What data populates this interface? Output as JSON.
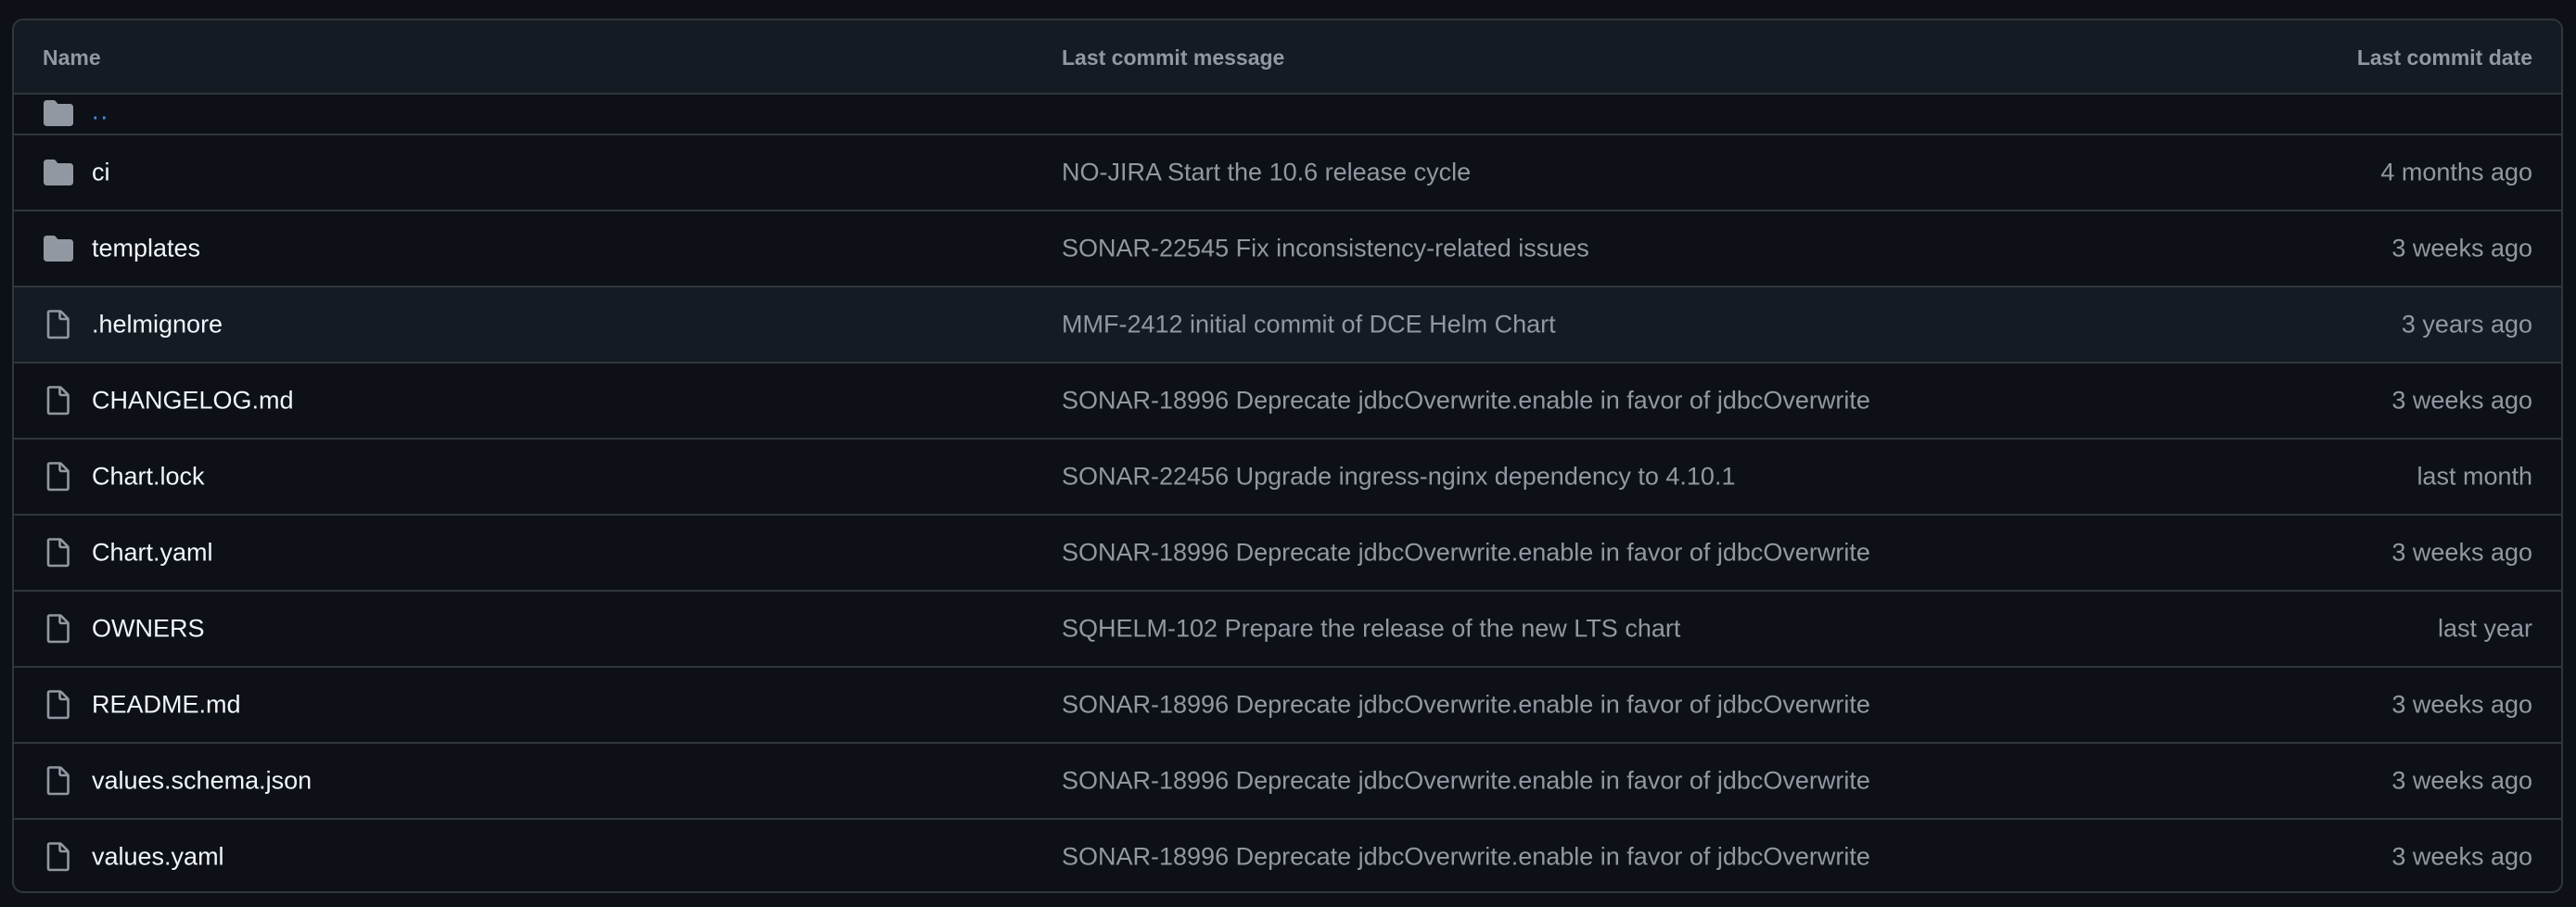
{
  "header": {
    "name": "Name",
    "message": "Last commit message",
    "date": "Last commit date"
  },
  "parent": {
    "label": "..",
    "icon": "folder-icon"
  },
  "rows": [
    {
      "name": "ci",
      "type": "dir",
      "icon": "folder-icon",
      "message": "NO-JIRA Start the 10.6 release cycle",
      "date": "4 months ago"
    },
    {
      "name": "templates",
      "type": "dir",
      "icon": "folder-icon",
      "message": "SONAR-22545 Fix inconsistency-related issues",
      "date": "3 weeks ago"
    },
    {
      "name": ".helmignore",
      "type": "file",
      "icon": "file-icon",
      "message": "MMF-2412 initial commit of DCE Helm Chart",
      "date": "3 years ago"
    },
    {
      "name": "CHANGELOG.md",
      "type": "file",
      "icon": "file-icon",
      "message": "SONAR-18996 Deprecate jdbcOverwrite.enable in favor of jdbcOverwrite",
      "date": "3 weeks ago"
    },
    {
      "name": "Chart.lock",
      "type": "file",
      "icon": "file-icon",
      "message": "SONAR-22456 Upgrade ingress-nginx dependency to 4.10.1",
      "date": "last month"
    },
    {
      "name": "Chart.yaml",
      "type": "file",
      "icon": "file-icon",
      "message": "SONAR-18996 Deprecate jdbcOverwrite.enable in favor of jdbcOverwrite",
      "date": "3 weeks ago"
    },
    {
      "name": "OWNERS",
      "type": "file",
      "icon": "file-icon",
      "message": "SQHELM-102 Prepare the release of the new LTS chart",
      "date": "last year"
    },
    {
      "name": "README.md",
      "type": "file",
      "icon": "file-icon",
      "message": "SONAR-18996 Deprecate jdbcOverwrite.enable in favor of jdbcOverwrite",
      "date": "3 weeks ago"
    },
    {
      "name": "values.schema.json",
      "type": "file",
      "icon": "file-icon",
      "message": "SONAR-18996 Deprecate jdbcOverwrite.enable in favor of jdbcOverwrite",
      "date": "3 weeks ago"
    },
    {
      "name": "values.yaml",
      "type": "file",
      "icon": "file-icon",
      "message": "SONAR-18996 Deprecate jdbcOverwrite.enable in favor of jdbcOverwrite",
      "date": "3 weeks ago"
    }
  ],
  "colors": {
    "background": "#0d1117",
    "header_bg": "#151b23",
    "border": "#30363d",
    "text_primary": "#f0f6fc",
    "text_muted": "#9198a1",
    "link": "#4493f8",
    "folder_icon": "#9198a1"
  }
}
